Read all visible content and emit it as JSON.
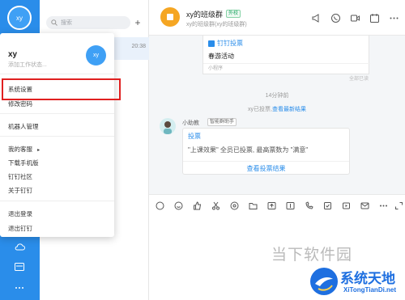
{
  "rail": {
    "avatar_text": "xy",
    "icons": [
      "cloud-icon",
      "mail-icon",
      "more-icon"
    ]
  },
  "conv_list": {
    "search_placeholder": "搜索",
    "active_time": "20:38"
  },
  "chat": {
    "group_name": "xy的班级群",
    "external_badge": "外校",
    "group_sub": "xy的班级群(xy的班级群)",
    "card1": {
      "title": "钉钉投票",
      "text": "春游活动",
      "footer": "小程序"
    },
    "all_read": "全部已读",
    "time_separator": "14分钟前",
    "vote_note_prefix": "xy已投票,",
    "vote_note_link": "查看最新结果",
    "sender": "小助教",
    "bot_tag": "智能群助手",
    "vote_card": {
      "title": "投票",
      "body": "\"上课效果\" 全员已投票, 最高票数为 \"满意\"",
      "link": "查看投票结果"
    }
  },
  "menu": {
    "user_name": "xy",
    "user_status": "添加工作状态...",
    "avatar_text": "xy",
    "items": {
      "system_settings": "系统设置",
      "change_password": "修改密码",
      "robot_management": "机器人管理",
      "my_customer_service": "我的客服",
      "download_mobile": "下载手机版",
      "dingtalk_community": "钉钉社区",
      "about_dingtalk": "关于钉钉",
      "logout": "退出登录",
      "quit_dingtalk": "退出钉钉"
    },
    "highlight_color": "#e02020"
  },
  "watermark": {
    "line1": "当下软件园",
    "line2": "系统天地",
    "line3": "XiTongTianDi.net"
  },
  "colors": {
    "brand_blue": "#2a8dea",
    "rail_blue": "#2a8dea",
    "accent_orange": "#f5a623"
  }
}
